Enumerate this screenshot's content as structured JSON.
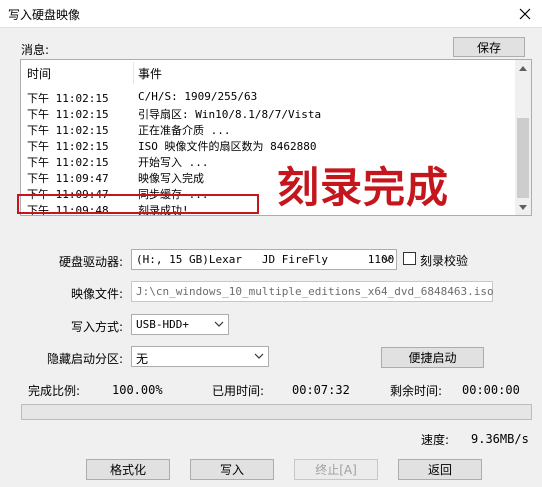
{
  "window": {
    "title": "写入硬盘映像"
  },
  "messages": {
    "label": "消息:",
    "save_button": "保存",
    "columns": {
      "time": "时间",
      "event": "事件"
    },
    "rows": [
      {
        "time": "下午 11:02:15",
        "event": "C/H/S: 1909/255/63"
      },
      {
        "time": "下午 11:02:15",
        "event": "引导扇区: Win10/8.1/8/7/Vista"
      },
      {
        "time": "下午 11:02:15",
        "event": "正在准备介质 ..."
      },
      {
        "time": "下午 11:02:15",
        "event": "ISO 映像文件的扇区数为 8462880"
      },
      {
        "time": "下午 11:02:15",
        "event": "开始写入 ..."
      },
      {
        "time": "下午 11:09:47",
        "event": "映像写入完成"
      },
      {
        "time": "下午 11:09:47",
        "event": "同步缓存 ..."
      },
      {
        "time": "下午 11:09:48",
        "event": "刻录成功!"
      }
    ],
    "annotation": "刻录完成",
    "highlight_color": "#c4161c"
  },
  "form": {
    "drive_label": "硬盘驱动器:",
    "drive_value": "(H:, 15 GB)Lexar   JD FireFly      1100",
    "verify_label": "刻录校验",
    "image_label": "映像文件:",
    "image_value": "J:\\cn_windows_10_multiple_editions_x64_dvd_6848463.iso",
    "write_mode_label": "写入方式:",
    "write_mode_value": "USB-HDD+",
    "hidden_partition_label": "隐藏启动分区:",
    "hidden_partition_value": "无",
    "quick_boot_button": "便捷启动"
  },
  "status": {
    "complete_label": "完成比例:",
    "complete_value": "100.00%",
    "elapsed_label": "已用时间:",
    "elapsed_value": "00:07:32",
    "remaining_label": "剩余时间:",
    "remaining_value": "00:00:00",
    "speed_label": "速度:",
    "speed_value": "9.36MB/s",
    "progress": 0
  },
  "buttons": {
    "format": "格式化",
    "write": "写入",
    "stop": "终止[A]",
    "back": "返回"
  }
}
